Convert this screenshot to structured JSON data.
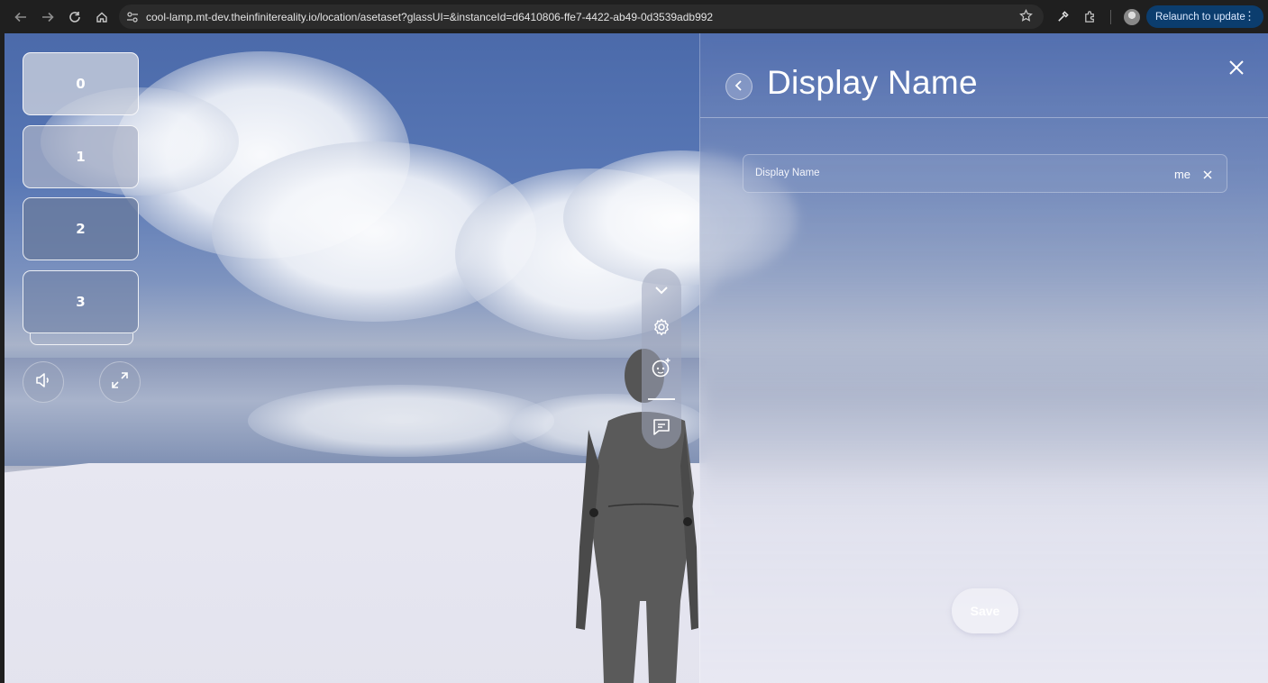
{
  "browser": {
    "url": "cool-lamp.mt-dev.theinfinitereality.io/location/asetaset?glassUI=&instanceId=d6410806-ffe7-4422-ab49-0d3539adb992",
    "relaunch_label": "Relaunch to update",
    "icons": [
      "back-arrow-icon",
      "forward-arrow-icon",
      "reload-icon",
      "home-icon",
      "site-settings-icon",
      "star-icon",
      "eyedropper-icon",
      "extensions-icon",
      "profile-avatar",
      "kebab-menu-icon"
    ]
  },
  "hud": {
    "slots": [
      {
        "label": "0"
      },
      {
        "label": "1"
      },
      {
        "label": "2"
      },
      {
        "label": "3"
      }
    ],
    "buttons": [
      "speaker-icon",
      "expand-icon"
    ]
  },
  "toolbar": {
    "items": [
      "chevron-down-icon",
      "gear-icon",
      "avatar-sparkle-icon",
      "chat-icon"
    ]
  },
  "panel": {
    "title": "Display Name",
    "field": {
      "label": "Display Name",
      "value": "me"
    },
    "save_label": "Save",
    "colors": {
      "text": "#ffffff",
      "relaunch_bg": "#0b3d6e"
    }
  }
}
